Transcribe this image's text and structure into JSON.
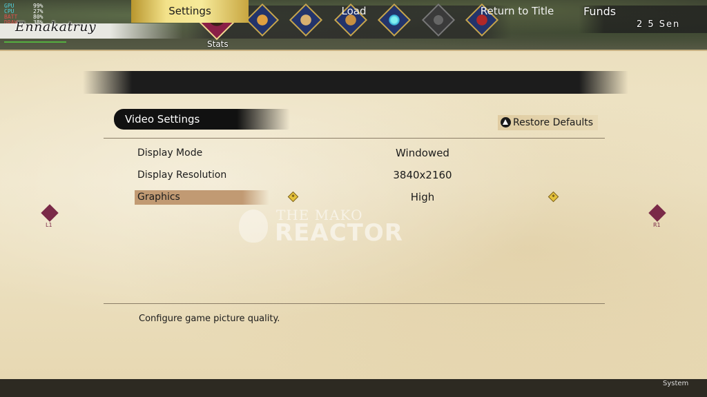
{
  "hud": {
    "perf": [
      {
        "key": "GPU",
        "value": "99%"
      },
      {
        "key": "CPU",
        "value": "27%"
      },
      {
        "key": "BATT",
        "value": "80%"
      },
      {
        "key": "DRAW",
        "value": "38%"
      }
    ],
    "character_name": "Ennakatruy"
  },
  "top_menu": {
    "items": [
      {
        "id": "stats",
        "icon": "character-portrait-icon",
        "label": "Stats",
        "active": true
      },
      {
        "id": "items",
        "icon": "pouch-icon"
      },
      {
        "id": "map",
        "icon": "scroll-icon"
      },
      {
        "id": "equipment",
        "icon": "warrior-equipment-icon"
      },
      {
        "id": "skills",
        "icon": "blue-flame-icon"
      },
      {
        "id": "locked",
        "icon": "lock-icon"
      },
      {
        "id": "journal",
        "icon": "red-book-icon"
      }
    ],
    "active_label": "Stats"
  },
  "funds": {
    "label": "Funds",
    "value": "2 5 Sen"
  },
  "tabs": [
    {
      "label": "Settings",
      "active": true
    },
    {
      "label": "Load",
      "active": false
    },
    {
      "label": "Return to Title",
      "active": false
    }
  ],
  "section": {
    "title": "Video Settings",
    "restore_label": "Restore Defaults",
    "restore_icon": "triangle-button-icon"
  },
  "settings": [
    {
      "label": "Display Mode",
      "value": "Windowed"
    },
    {
      "label": "Display Resolution",
      "value": "3840x2160"
    },
    {
      "label": "Graphics",
      "value": "High",
      "selected": true
    }
  ],
  "nav": {
    "left_label": "L1",
    "right_label": "R1"
  },
  "watermark": {
    "line1": "THE MAKO",
    "line2": "REACTOR"
  },
  "description": "Configure game picture quality.",
  "footer": {
    "system_label": "System"
  },
  "colors": {
    "accent_gold": "#f3e28a",
    "selected_row": "#c19a73",
    "parchment": "#ece0bf",
    "tab_bar": "#1c1c1c",
    "nav_arrow": "#7a2a48"
  }
}
